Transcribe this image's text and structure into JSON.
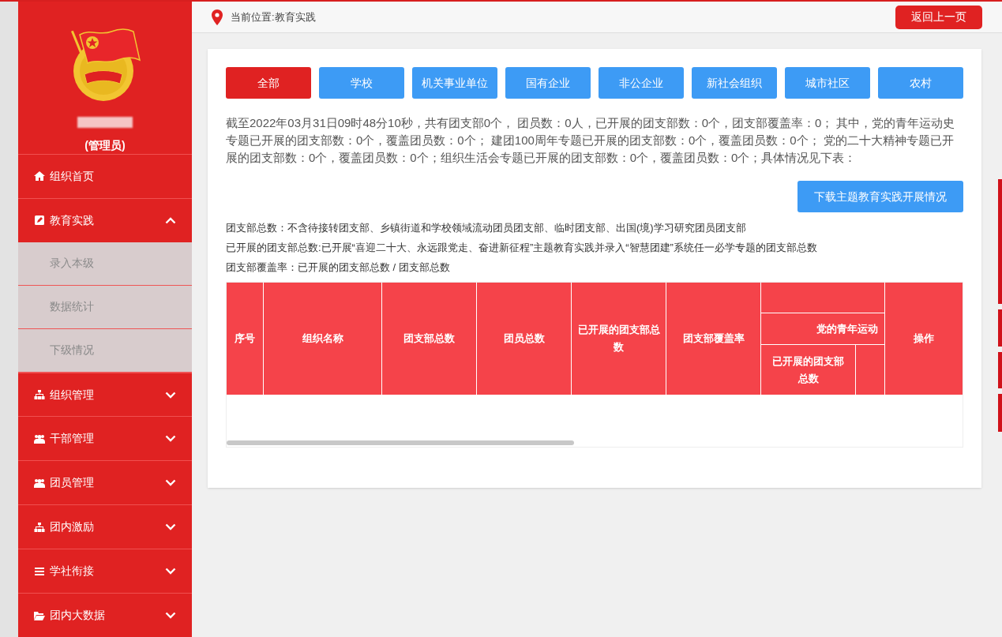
{
  "sidebar": {
    "role": "(管理员)",
    "items": [
      {
        "label": "组织首页",
        "kind": "link"
      },
      {
        "label": "教育实践",
        "kind": "group",
        "expanded": true,
        "children": [
          {
            "label": "录入本级"
          },
          {
            "label": "数据统计"
          },
          {
            "label": "下级情况"
          }
        ]
      },
      {
        "label": "组织管理",
        "kind": "group",
        "expanded": false
      },
      {
        "label": "干部管理",
        "kind": "group",
        "expanded": false
      },
      {
        "label": "团员管理",
        "kind": "group",
        "expanded": false
      },
      {
        "label": "团内激励",
        "kind": "group",
        "expanded": false
      },
      {
        "label": "学社衔接",
        "kind": "group",
        "expanded": false
      },
      {
        "label": "团内大数据",
        "kind": "group",
        "expanded": false
      }
    ]
  },
  "breadcrumb": "当前位置:教育实践",
  "back_button": "返回上一页",
  "tabs": [
    {
      "label": "全部",
      "selected": true
    },
    {
      "label": "学校",
      "selected": false
    },
    {
      "label": "机关事业单位",
      "selected": false
    },
    {
      "label": "国有企业",
      "selected": false
    },
    {
      "label": "非公企业",
      "selected": false
    },
    {
      "label": "新社会组织",
      "selected": false
    },
    {
      "label": "城市社区",
      "selected": false
    },
    {
      "label": "农村",
      "selected": false
    }
  ],
  "summary": "截至2022年03月31日09时48分10秒，共有团支部0个， 团员数：0人，已开展的团支部数：0个，团支部覆盖率：0； 其中，党的青年运动史专题已开展的团支部数：0个，覆盖团员数：0个； 建团100周年专题已开展的团支部数：0个，覆盖团员数：0个； 党的二十大精神专题已开展的团支部数：0个，覆盖团员数：0个；组织生活会专题已开展的团支部数：0个，覆盖团员数：0个；具体情况见下表：",
  "download_button": "下载主题教育实践开展情况",
  "notes": [
    "团支部总数：不含待接转团支部、乡镇街道和学校领域流动团员团支部、临时团支部、出国(境)学习研究团员团支部",
    "已开展的团支部总数:已开展“喜迎二十大、永远跟党走、奋进新征程”主题教育实践并录入“智慧团建”系统任一必学专题的团支部总数",
    "团支部覆盖率：已开展的团支部总数 / 团支部总数"
  ],
  "table": {
    "columns": [
      "序号",
      "组织名称",
      "团支部总数",
      "团员总数",
      "已开展的团支部总数",
      "团支部覆盖率"
    ],
    "group_column": {
      "label": "党的青年运动",
      "sub_columns": [
        "已开展的团支部总数"
      ]
    },
    "action_column": "操作"
  }
}
